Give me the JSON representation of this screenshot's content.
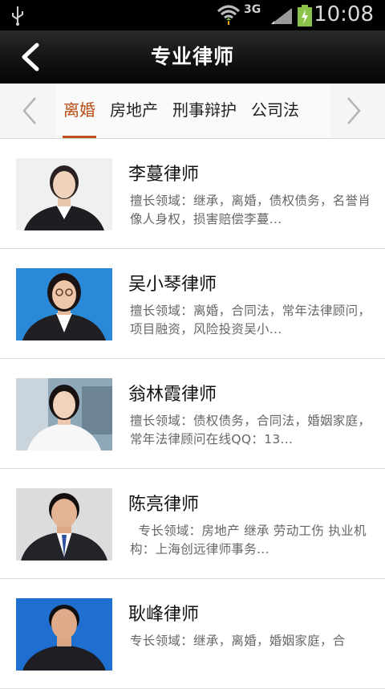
{
  "status_bar": {
    "network": "3G",
    "time": "10:08",
    "icons": [
      "usb-icon",
      "wifi-icon",
      "signal-icon",
      "battery-icon"
    ]
  },
  "header": {
    "title": "专业律师",
    "back_icon": "back-chevron-icon"
  },
  "tabs": {
    "items": [
      "离婚",
      "房地产",
      "刑事辩护",
      "公司法"
    ],
    "active_index": 0,
    "active_color": "#c05020"
  },
  "lawyers": [
    {
      "name": "李蔓律师",
      "description": "擅长领域：继承，离婚，债权债务，名誉肖像人身权，损害赔偿李蔓..."
    },
    {
      "name": "吴小琴律师",
      "description": "擅长领域：离婚，合同法，常年法律顾问，项目融资，风险投资吴小..."
    },
    {
      "name": "翁林霞律师",
      "description": "擅长领域：债权债务，合同法，婚姻家庭，常年法律顾问在线QQ：13..."
    },
    {
      "name": "陈亮律师",
      "description": "  专长领域：房地产 继承 劳动工伤 执业机构：上海创远律师事务..."
    },
    {
      "name": "耿峰律师",
      "description": "专长领域：继承，离婚，婚姻家庭，合"
    }
  ]
}
